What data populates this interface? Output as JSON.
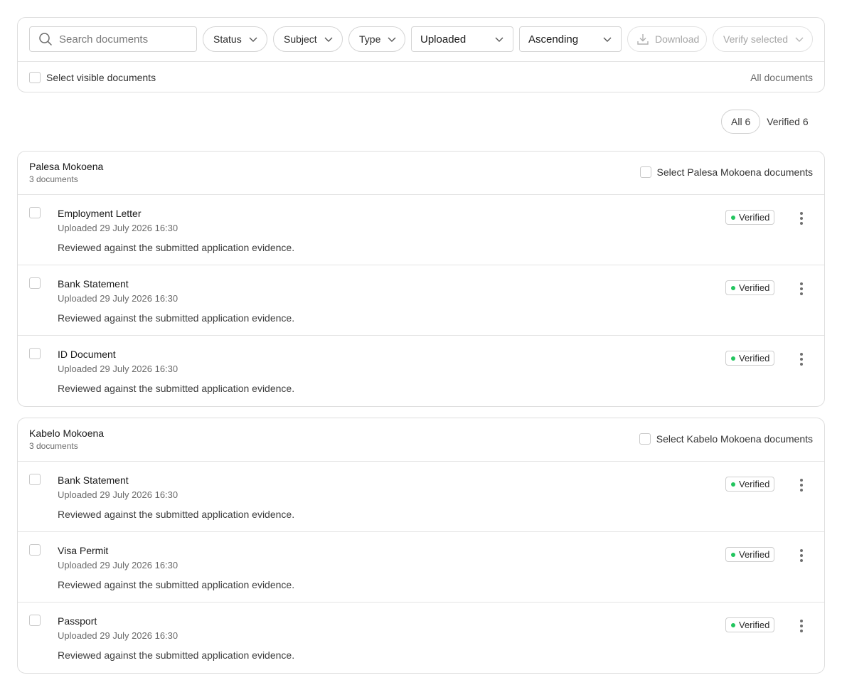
{
  "toolbar": {
    "search_placeholder": "Search documents",
    "filters": {
      "status": "Status",
      "subject": "Subject",
      "type": "Type"
    },
    "sort_field": "Uploaded",
    "sort_order": "Ascending",
    "download_label": "Download",
    "verify_label": "Verify selected"
  },
  "selection": {
    "select_visible_label": "Select visible documents",
    "scope_label": "All documents"
  },
  "tabs": {
    "all": "All 6",
    "verified": "Verified 6"
  },
  "colors": {
    "verified_dot": "#22c55e"
  },
  "groups": [
    {
      "name": "Palesa Mokoena",
      "count": "3 documents",
      "select_label": "Select Palesa Mokoena documents",
      "documents": [
        {
          "title": "Employment Letter",
          "uploaded": "Uploaded 29 July 2026 16:30",
          "description": "Reviewed against the submitted application evidence.",
          "status": "Verified"
        },
        {
          "title": "Bank Statement",
          "uploaded": "Uploaded 29 July 2026 16:30",
          "description": "Reviewed against the submitted application evidence.",
          "status": "Verified"
        },
        {
          "title": "ID Document",
          "uploaded": "Uploaded 29 July 2026 16:30",
          "description": "Reviewed against the submitted application evidence.",
          "status": "Verified"
        }
      ]
    },
    {
      "name": "Kabelo Mokoena",
      "count": "3 documents",
      "select_label": "Select Kabelo Mokoena documents",
      "documents": [
        {
          "title": "Bank Statement",
          "uploaded": "Uploaded 29 July 2026 16:30",
          "description": "Reviewed against the submitted application evidence.",
          "status": "Verified"
        },
        {
          "title": "Visa Permit",
          "uploaded": "Uploaded 29 July 2026 16:30",
          "description": "Reviewed against the submitted application evidence.",
          "status": "Verified"
        },
        {
          "title": "Passport",
          "uploaded": "Uploaded 29 July 2026 16:30",
          "description": "Reviewed against the submitted application evidence.",
          "status": "Verified"
        }
      ]
    }
  ]
}
